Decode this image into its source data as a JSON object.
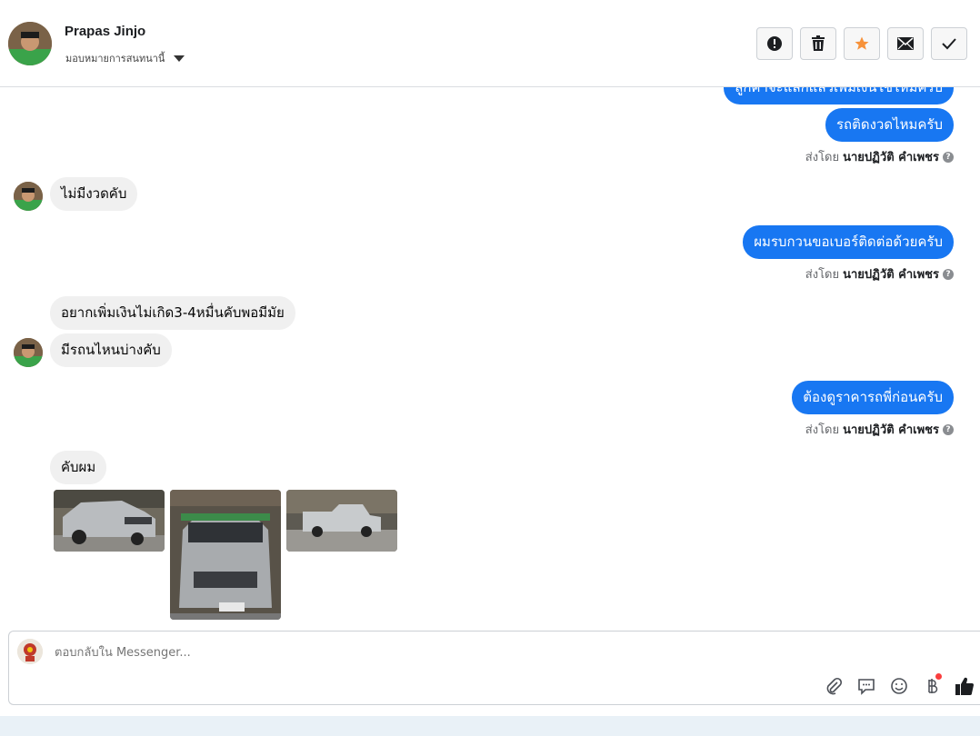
{
  "header": {
    "contact_name": "Prapas Jinjo",
    "assign_label": "มอบหมายการสนทนานี้",
    "actions": [
      {
        "icon": "alert-icon",
        "label": "spam"
      },
      {
        "icon": "trash-icon",
        "label": "delete"
      },
      {
        "icon": "star-icon",
        "label": "star"
      },
      {
        "icon": "envelope-icon",
        "label": "mark unread"
      },
      {
        "icon": "check-icon",
        "label": "done"
      }
    ]
  },
  "messages": {
    "m0": "ลูกค้าจะแลกแล้วเพิ่มเงินใช่ไหมครับ",
    "m1": "รถติดงวดไหมครับ",
    "sentby_label": "ส่งโดย",
    "sender_name": "นายปฏิวัติ คำเพชร",
    "m2": "ไม่มีงวดคับ",
    "m3": "ผมรบกวนขอเบอร์ติดต่อด้วยครับ",
    "m4": "อยากเพิ่มเงินไม่เกิด3-4หมื่นคับพอมีมัย",
    "m5": "มีรถนไหนบ่างคับ",
    "m6": "ต้องดูราคารถพี่ก่อนครับ",
    "m7": "คับผม"
  },
  "reply": {
    "placeholder": "ตอบกลับใน Messenger...",
    "tools": [
      "attachment-icon",
      "chat-bubble-icon",
      "emoji-icon",
      "baht-icon",
      "thumbs-up-icon"
    ]
  },
  "colors": {
    "outgoing": "#1877f2",
    "incoming": "#f0f0f0",
    "accent_star": "#f7923a"
  }
}
